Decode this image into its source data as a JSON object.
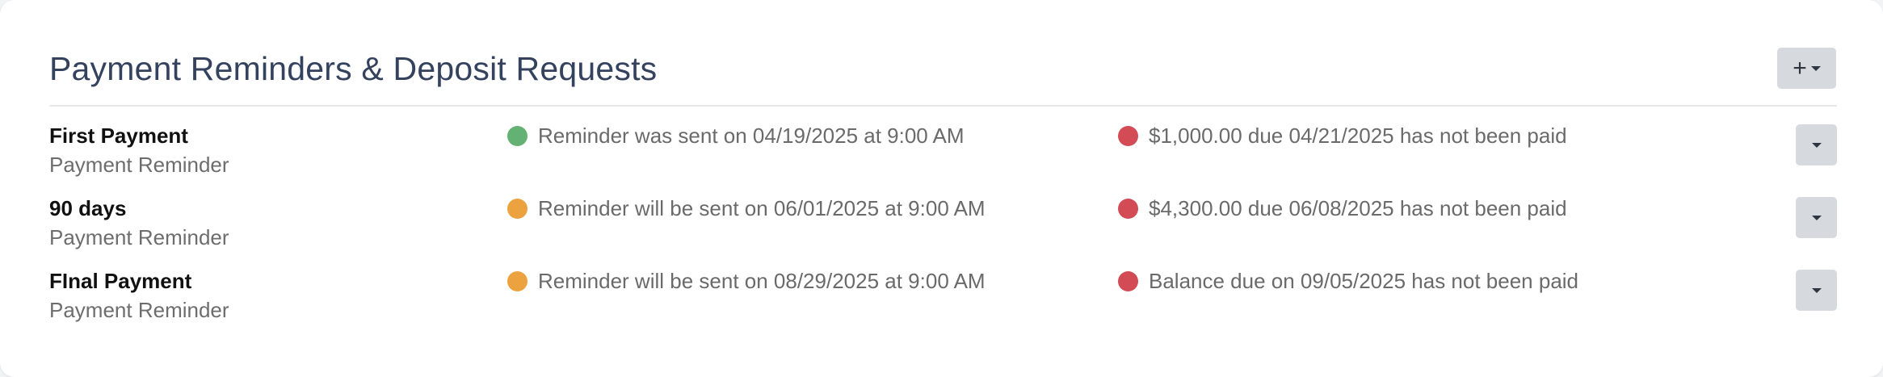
{
  "section": {
    "title": "Payment Reminders & Deposit Requests",
    "add_button_label": "+"
  },
  "colors": {
    "sent": "#63b173",
    "scheduled": "#eba23f",
    "unpaid": "#d24b55"
  },
  "reminders": [
    {
      "name": "First Payment",
      "type": "Payment Reminder",
      "reminder_status": "sent",
      "reminder_text": "Reminder was sent on 04/19/2025 at 9:00 AM",
      "payment_status": "unpaid",
      "payment_text": "$1,000.00 due 04/21/2025 has not been paid"
    },
    {
      "name": "90 days",
      "type": "Payment Reminder",
      "reminder_status": "scheduled",
      "reminder_text": "Reminder will be sent on 06/01/2025 at 9:00 AM",
      "payment_status": "unpaid",
      "payment_text": "$4,300.00 due 06/08/2025 has not been paid"
    },
    {
      "name": "FInal Payment",
      "type": "Payment Reminder",
      "reminder_status": "scheduled",
      "reminder_text": "Reminder will be sent on 08/29/2025 at 9:00 AM",
      "payment_status": "unpaid",
      "payment_text": "Balance due on 09/05/2025 has not been paid"
    }
  ]
}
